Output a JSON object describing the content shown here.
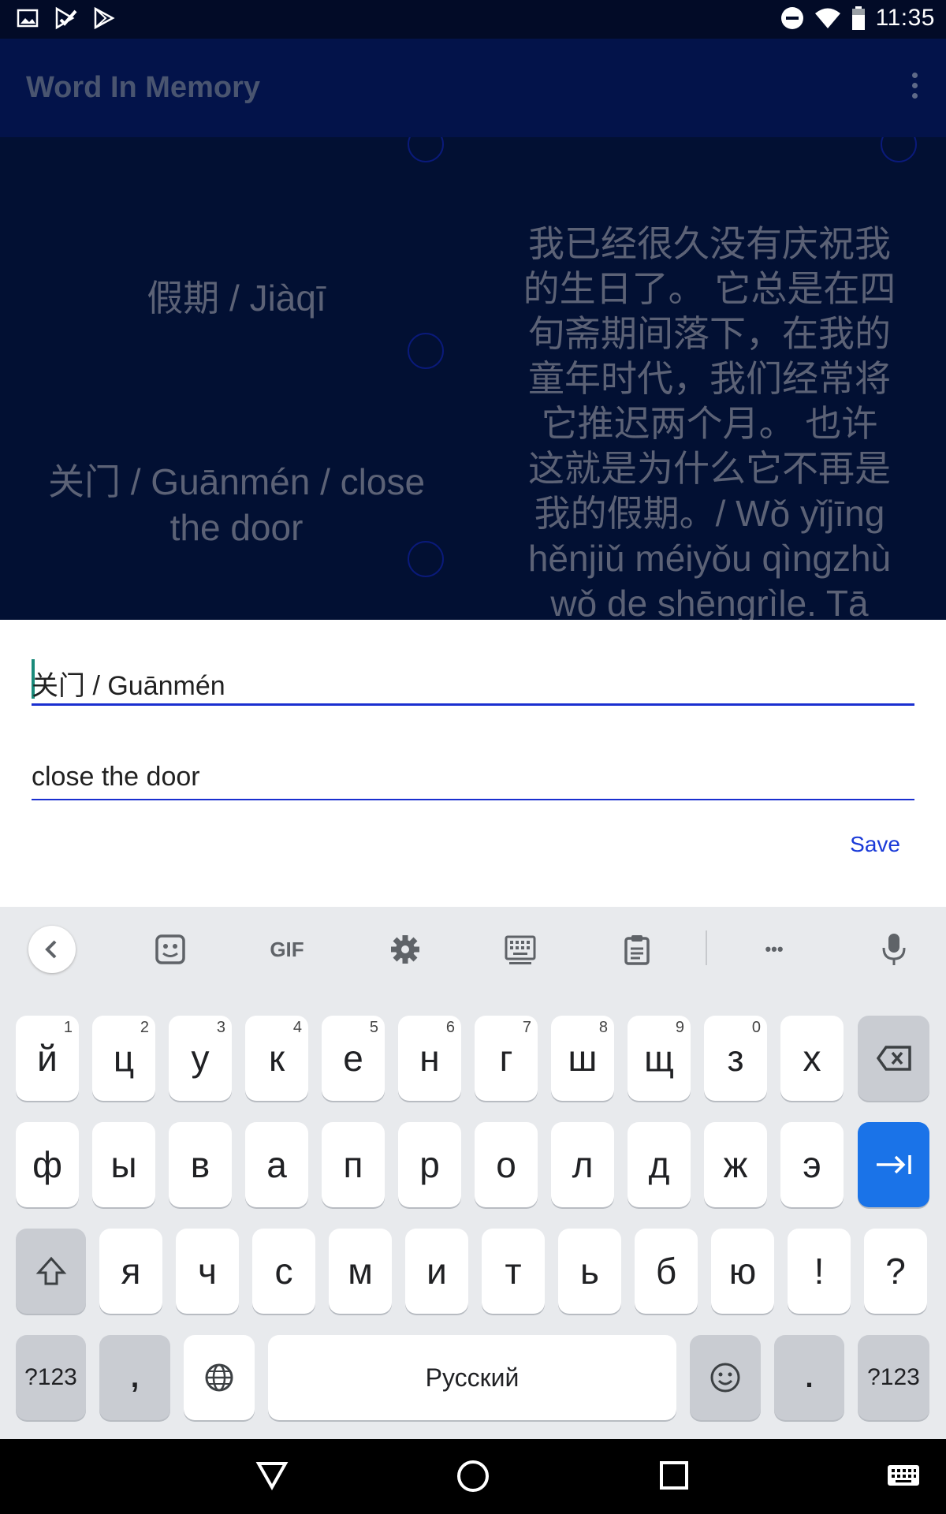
{
  "status_bar": {
    "time": "11:35",
    "left_icons": [
      "image-icon",
      "play-check-icon",
      "play-store-icon"
    ],
    "right_icons": [
      "do-not-disturb-icon",
      "wifi-icon",
      "battery-icon"
    ]
  },
  "app_bar": {
    "title": "Word In Memory",
    "menu_icon": "more-vert-icon"
  },
  "cards": {
    "word1": "假期 / Jiàqī",
    "word2_line1": "关门 / Guānmén / close",
    "word2_line2": "the door",
    "sentence_lines": [
      "我已经很久没有庆祝我",
      "的生日了。 它总是在四",
      "旬斋期间落下，在我的",
      "童年时代，我们经常将",
      "它推迟两个月。 也许",
      "这就是为什么它不再是",
      "我的假期。/ Wǒ yǐjīng",
      "hěnjiǔ méiyǒu qìngzhù",
      "wǒ de shēngrìle. Tā"
    ]
  },
  "form": {
    "word_value": "关门 / Guānmén",
    "translation_value": "close the door",
    "save_label": "Save"
  },
  "keyboard": {
    "toolbar": {
      "gif_label": "GIF",
      "more_label": "•••"
    },
    "row1": [
      {
        "key": "й",
        "hint": "1"
      },
      {
        "key": "ц",
        "hint": "2"
      },
      {
        "key": "у",
        "hint": "3"
      },
      {
        "key": "к",
        "hint": "4"
      },
      {
        "key": "е",
        "hint": "5"
      },
      {
        "key": "н",
        "hint": "6"
      },
      {
        "key": "г",
        "hint": "7"
      },
      {
        "key": "ш",
        "hint": "8"
      },
      {
        "key": "щ",
        "hint": "9"
      },
      {
        "key": "з",
        "hint": "0"
      },
      {
        "key": "х",
        "hint": ""
      }
    ],
    "row2": [
      "ф",
      "ы",
      "в",
      "а",
      "п",
      "р",
      "о",
      "л",
      "д",
      "ж",
      "э"
    ],
    "row3": [
      "я",
      "ч",
      "с",
      "м",
      "и",
      "т",
      "ь",
      "б",
      "ю",
      "!",
      "?"
    ],
    "row4": {
      "symbols_left": "?123",
      "comma": ",",
      "space": "Русский",
      "period": ".",
      "symbols_right": "?123"
    }
  },
  "colors": {
    "app_bar": "#03134a",
    "content_bg": "#021033",
    "accent": "#1a2fd0",
    "enter_key": "#1a73e8"
  }
}
